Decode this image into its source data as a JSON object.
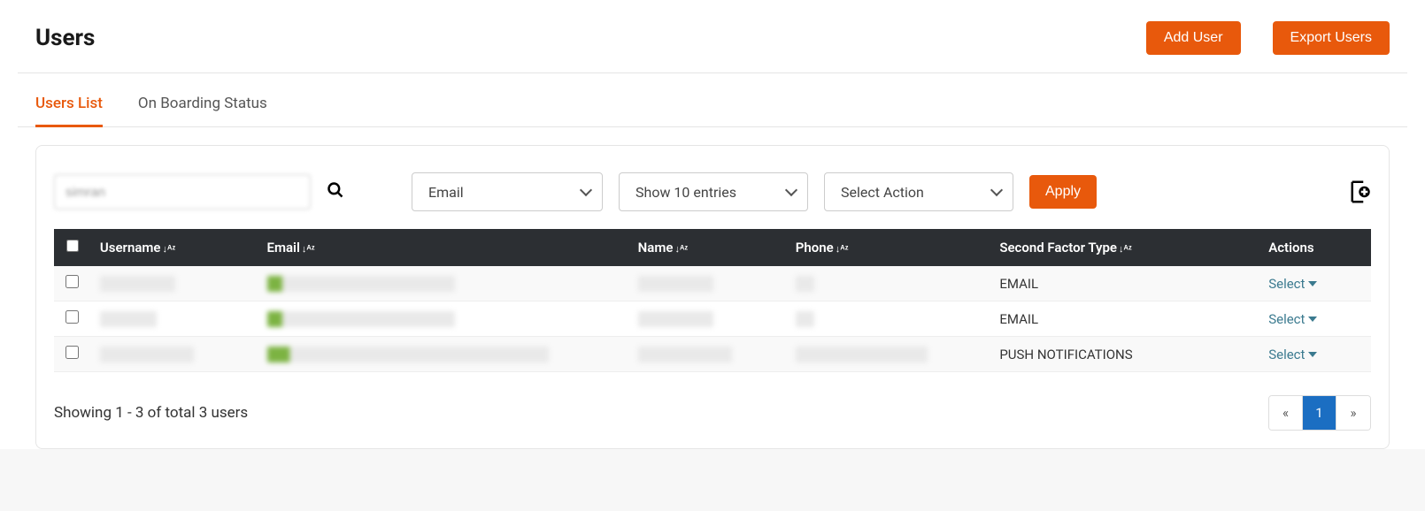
{
  "header": {
    "title": "Users",
    "add_user_label": "Add User",
    "export_users_label": "Export Users"
  },
  "tabs": [
    {
      "label": "Users List",
      "active": true
    },
    {
      "label": "On Boarding Status",
      "active": false
    }
  ],
  "controls": {
    "search_value": "simran",
    "filter_by": "Email",
    "entries": "Show 10 entries",
    "action": "Select Action",
    "apply_label": "Apply"
  },
  "table": {
    "columns": [
      "Username",
      "Email",
      "Name",
      "Phone",
      "Second Factor Type",
      "Actions"
    ],
    "rows": [
      {
        "username": "████████",
        "email": "████████████████████",
        "name": "████████",
        "phone": "██",
        "second_factor": "EMAIL",
        "action_label": "Select"
      },
      {
        "username": "██████",
        "email": "████████████████████",
        "name": "████████",
        "phone": "██",
        "second_factor": "EMAIL",
        "action_label": "Select"
      },
      {
        "username": "██████████",
        "email": "██████████████████████████████",
        "name": "██████████",
        "phone": "██████████████",
        "second_factor": "PUSH NOTIFICATIONS",
        "action_label": "Select"
      }
    ]
  },
  "footer": {
    "summary": "Showing 1 - 3 of total 3 users",
    "prev": "«",
    "page": "1",
    "next": "»"
  }
}
